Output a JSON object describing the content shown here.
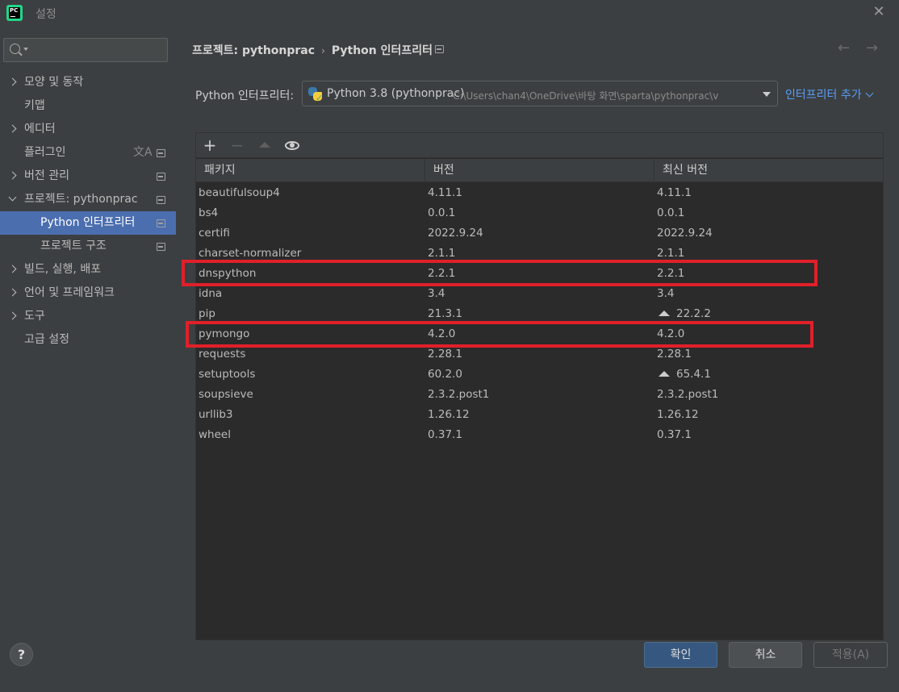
{
  "window": {
    "title": "설정",
    "app_icon_text": "PC"
  },
  "search": {
    "placeholder": "",
    "value": ""
  },
  "sidebar": {
    "items": [
      {
        "label": "모양 및 동작",
        "arrow": "right"
      },
      {
        "label": "키맵"
      },
      {
        "label": "에디터",
        "arrow": "right"
      },
      {
        "label": "플러그인",
        "icons": [
          "translate-icon",
          "project-settings-icon"
        ]
      },
      {
        "label": "버전 관리",
        "arrow": "right",
        "icons": [
          "project-settings-icon"
        ]
      },
      {
        "label": "프로젝트: pythonprac",
        "arrow": "down",
        "icons": [
          "project-settings-icon"
        ]
      },
      {
        "label": "Python 인터프리터",
        "selected": true,
        "icons": [
          "project-settings-icon"
        ]
      },
      {
        "label": "프로젝트 구조",
        "icons": [
          "project-settings-icon"
        ]
      },
      {
        "label": "빌드, 실행, 배포",
        "arrow": "right"
      },
      {
        "label": "언어 및 프레임워크",
        "arrow": "right"
      },
      {
        "label": "도구",
        "arrow": "right"
      },
      {
        "label": "고급 설정"
      }
    ],
    "help_label": "?"
  },
  "breadcrumb": {
    "parent": "프로젝트: pythonprac",
    "current": "Python 인터프리터"
  },
  "interpreter": {
    "label": "Python 인터프리터:",
    "selected_name": "Python 3.8 (pythonprac)",
    "selected_path": "C:\\Users\\chan4\\OneDrive\\바탕 화면\\sparta\\pythonprac\\v",
    "add_label": "인터프리터 추가"
  },
  "packages": {
    "columns": [
      "패키지",
      "버전",
      "최신 버전"
    ],
    "rows": [
      {
        "name": "beautifulsoup4",
        "version": "4.11.1",
        "latest": "4.11.1",
        "upgrade": false
      },
      {
        "name": "bs4",
        "version": "0.0.1",
        "latest": "0.0.1",
        "upgrade": false
      },
      {
        "name": "certifi",
        "version": "2022.9.24",
        "latest": "2022.9.24",
        "upgrade": false
      },
      {
        "name": "charset-normalizer",
        "version": "2.1.1",
        "latest": "2.1.1",
        "upgrade": false
      },
      {
        "name": "dnspython",
        "version": "2.2.1",
        "latest": "2.2.1",
        "upgrade": false,
        "highlighted": true
      },
      {
        "name": "idna",
        "version": "3.4",
        "latest": "3.4",
        "upgrade": false
      },
      {
        "name": "pip",
        "version": "21.3.1",
        "latest": "22.2.2",
        "upgrade": true
      },
      {
        "name": "pymongo",
        "version": "4.2.0",
        "latest": "4.2.0",
        "upgrade": false,
        "highlighted": true
      },
      {
        "name": "requests",
        "version": "2.28.1",
        "latest": "2.28.1",
        "upgrade": false
      },
      {
        "name": "setuptools",
        "version": "60.2.0",
        "latest": "65.4.1",
        "upgrade": true
      },
      {
        "name": "soupsieve",
        "version": "2.3.2.post1",
        "latest": "2.3.2.post1",
        "upgrade": false
      },
      {
        "name": "urllib3",
        "version": "1.26.12",
        "latest": "1.26.12",
        "upgrade": false
      },
      {
        "name": "wheel",
        "version": "0.37.1",
        "latest": "0.37.1",
        "upgrade": false
      }
    ]
  },
  "buttons": {
    "ok": "확인",
    "cancel": "취소",
    "apply": "적용(A)"
  },
  "colors": {
    "background": "#3c3f41",
    "table_background": "#2b2b2b",
    "selection": "#4b6eaf",
    "link": "#589df6",
    "highlight_box": "#e0202a",
    "primary_button": "#365880"
  }
}
